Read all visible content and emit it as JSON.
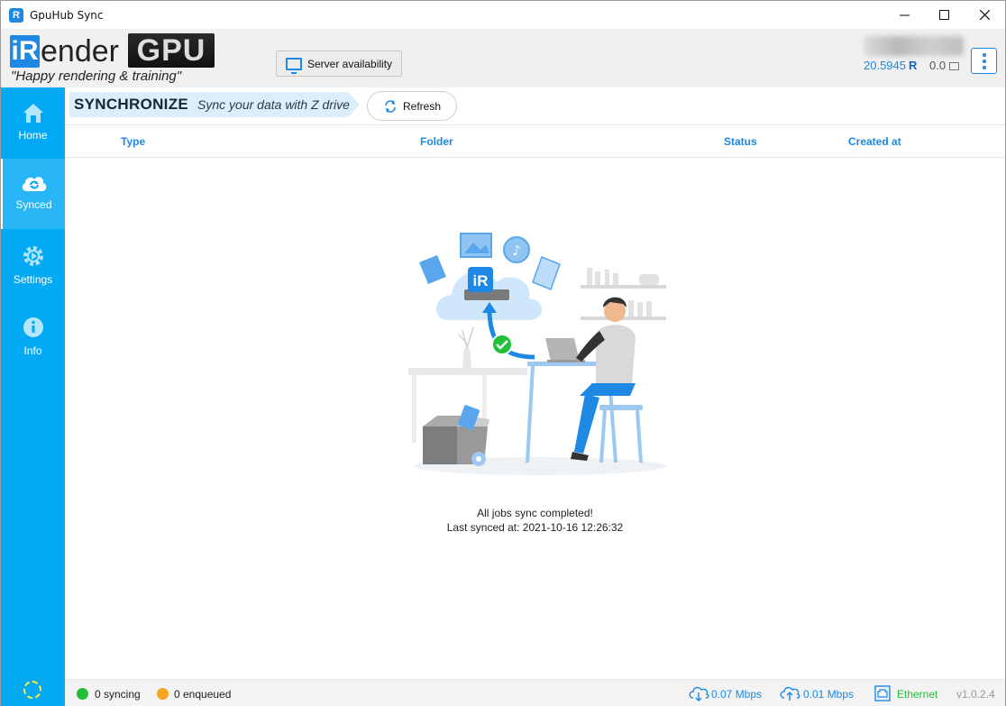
{
  "window": {
    "title": "GpuHub Sync",
    "app_icon_letter": "R"
  },
  "header": {
    "logo_i": "i",
    "logo_r": "R",
    "logo_ender": "ender",
    "logo_gpu": "GPU",
    "tagline": "\"Happy rendering & training\"",
    "server_button": "Server availability",
    "balance": "20.5945",
    "balance_unit": "R",
    "credit": "0.0"
  },
  "sidebar": {
    "items": [
      {
        "label": "Home",
        "icon": "home-icon"
      },
      {
        "label": "Synced",
        "icon": "cloud-sync-icon",
        "active": true
      },
      {
        "label": "Settings",
        "icon": "gear-icon"
      },
      {
        "label": "Info",
        "icon": "info-icon"
      }
    ]
  },
  "toolbar": {
    "heading": "SYNCHRONIZE",
    "subheading": "Sync your data with Z drive",
    "refresh": "Refresh"
  },
  "table": {
    "columns": [
      "Type",
      "Folder",
      "Status",
      "Created at"
    ]
  },
  "empty_state": {
    "line1": "All jobs sync completed!",
    "line2": "Last synced at: 2021-10-16 12:26:32"
  },
  "statusbar": {
    "syncing": "0 syncing",
    "enqueued": "0 enqueued",
    "download": "0.07 Mbps",
    "upload": "0.01 Mbps",
    "network": "Ethernet",
    "version": "v1.0.2.4"
  },
  "colors": {
    "accent": "#1e88e5",
    "sidebar": "#03a9f4",
    "ok": "#22c03a",
    "pending": "#f5a623"
  }
}
